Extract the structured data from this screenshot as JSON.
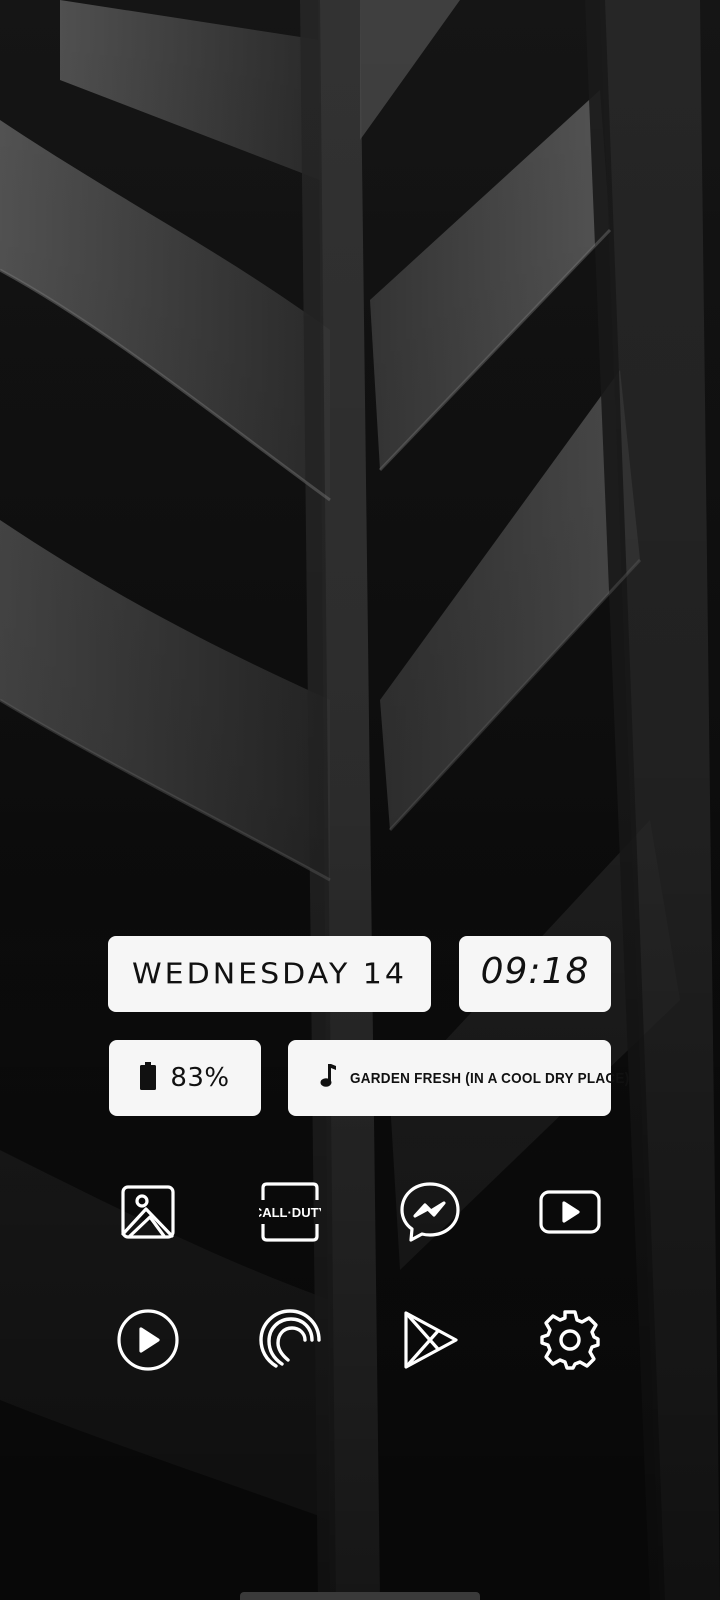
{
  "widgets": {
    "date": "WEDNESDAY 14",
    "time": "09:18",
    "battery": "83%",
    "now_playing": "GARDEN FRESH (IN A COOL DRY PLACE)"
  },
  "apps": [
    {
      "name": "gallery",
      "icon": "gallery-icon"
    },
    {
      "name": "call-of-duty",
      "icon": "call-of-duty-icon",
      "label": "CALL·DUTY"
    },
    {
      "name": "messenger",
      "icon": "messenger-icon"
    },
    {
      "name": "youtube",
      "icon": "youtube-icon"
    },
    {
      "name": "video-player",
      "icon": "play-circle-icon"
    },
    {
      "name": "picsart",
      "icon": "picsart-icon"
    },
    {
      "name": "play-store",
      "icon": "play-store-icon"
    },
    {
      "name": "settings",
      "icon": "gear-icon"
    }
  ],
  "colors": {
    "widget_bg": "#f6f6f6",
    "widget_text": "#111111",
    "icon_color": "#ffffff",
    "wallpaper_base": "#0b0b0b"
  }
}
